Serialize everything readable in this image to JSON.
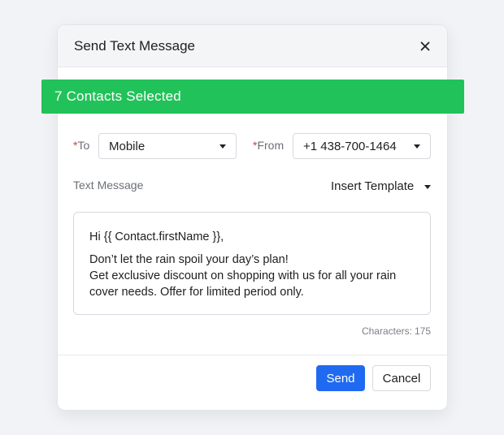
{
  "dialog": {
    "title": "Send Text Message",
    "close_icon": "close-icon"
  },
  "banner": {
    "text": "7 Contacts Selected",
    "color": "#22c25a"
  },
  "form": {
    "to": {
      "required_mark": "*",
      "label": "To",
      "value": "Mobile"
    },
    "from": {
      "required_mark": "*",
      "label": "From",
      "value": "+1 438-700-1464"
    },
    "message_label": "Text Message",
    "insert_template_label": "Insert Template",
    "message": {
      "greeting": "Hi {{ Contact.firstName }},",
      "line1": "Don’t let the rain spoil your day’s plan!",
      "line2": "Get exclusive discount on shopping with us for all your rain cover needs. Offer for limited period only."
    },
    "characters_label": "Characters:",
    "characters_count": "175"
  },
  "footer": {
    "send_label": "Send",
    "cancel_label": "Cancel",
    "send_color": "#1f6af0"
  }
}
